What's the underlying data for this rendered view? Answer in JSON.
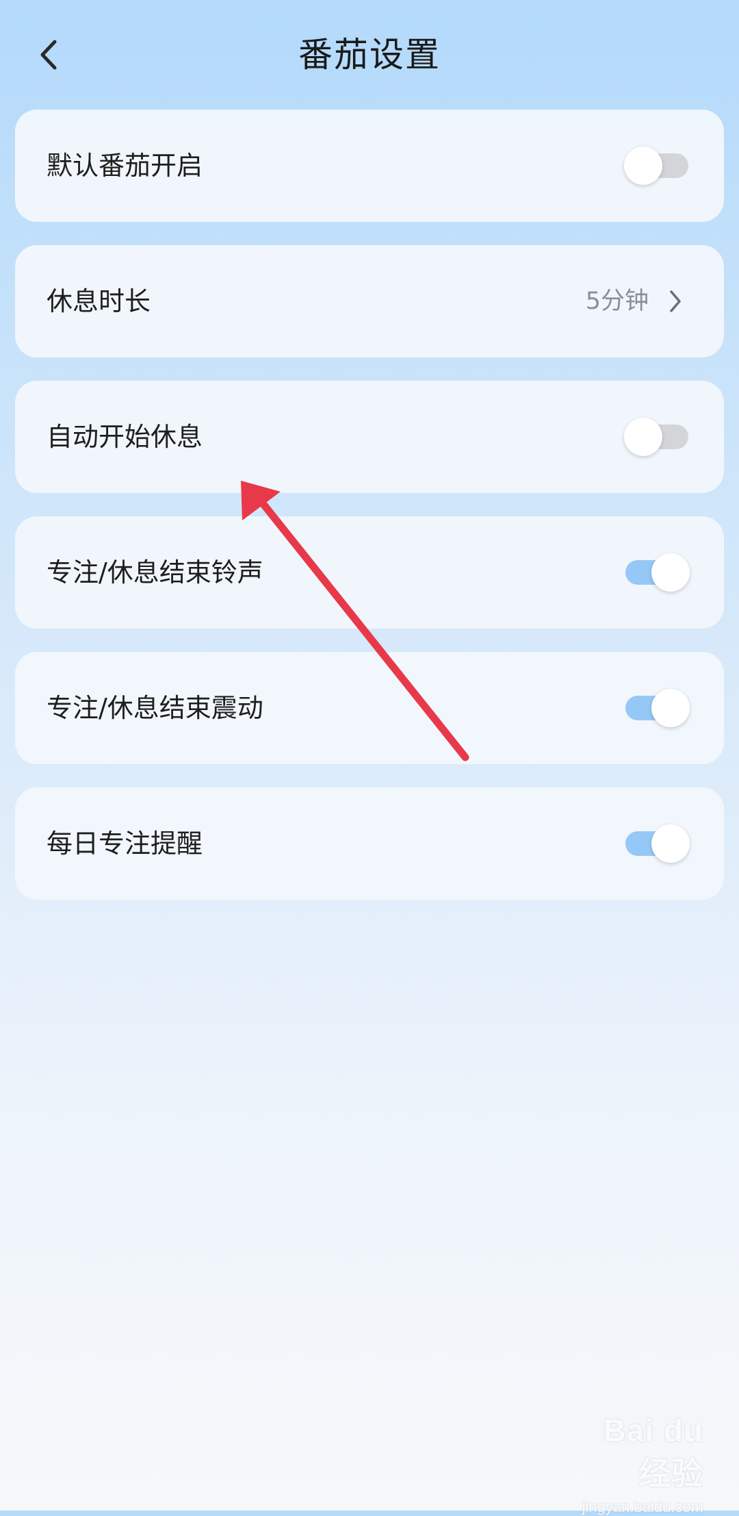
{
  "header": {
    "title": "番茄设置",
    "back_icon": "chevron-left-icon"
  },
  "settings": [
    {
      "label": "默认番茄开启",
      "control": "toggle",
      "on": false
    },
    {
      "label": "休息时长",
      "control": "value",
      "value": "5分钟",
      "icon": "chevron-right-icon"
    },
    {
      "label": "自动开始休息",
      "control": "toggle",
      "on": false
    },
    {
      "label": "专注/休息结束铃声",
      "control": "toggle",
      "on": true
    },
    {
      "label": "专注/休息结束震动",
      "control": "toggle",
      "on": true
    },
    {
      "label": "每日专注提醒",
      "control": "toggle",
      "on": true
    }
  ],
  "colors": {
    "toggle_on_track": "#95c8f6",
    "toggle_off_track": "#d3d5d9",
    "annotation_arrow": "#e8394a",
    "background_top": "#b3d9fb",
    "background_bottom": "#f6f8fa"
  },
  "watermark": {
    "logo": "Bai du 经验",
    "url": "jingyan.baidu.com"
  }
}
